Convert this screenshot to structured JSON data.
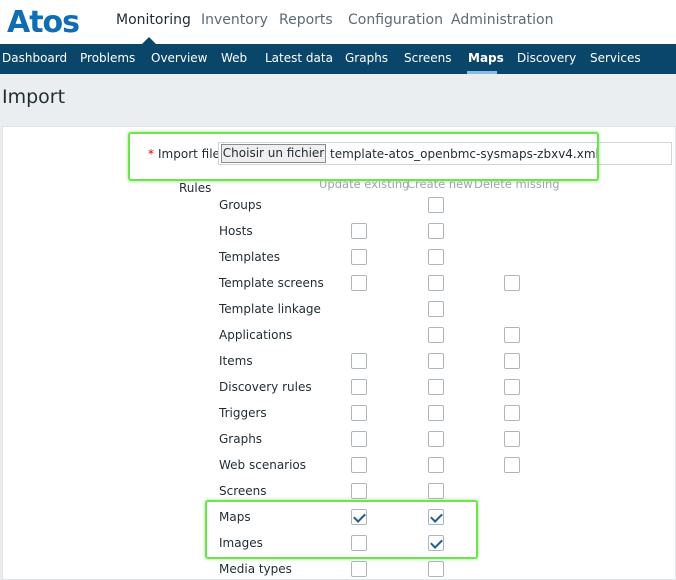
{
  "header": {
    "logo": "Atos",
    "menu": [
      {
        "label": "Monitoring",
        "active": true
      },
      {
        "label": "Inventory",
        "active": false
      },
      {
        "label": "Reports",
        "active": false
      },
      {
        "label": "Configuration",
        "active": false
      },
      {
        "label": "Administration",
        "active": false
      }
    ]
  },
  "subnav": [
    {
      "label": "Dashboard",
      "active": false
    },
    {
      "label": "Problems",
      "active": false
    },
    {
      "label": "Overview",
      "active": false
    },
    {
      "label": "Web",
      "active": false
    },
    {
      "label": "Latest data",
      "active": false
    },
    {
      "label": "Graphs",
      "active": false
    },
    {
      "label": "Screens",
      "active": false
    },
    {
      "label": "Maps",
      "active": true
    },
    {
      "label": "Discovery",
      "active": false
    },
    {
      "label": "Services",
      "active": false
    }
  ],
  "page_title": "Import",
  "import_file": {
    "required_mark": "*",
    "label": "Import file",
    "button": "Choisir un fichier",
    "filename": "template-atos_openbmc-sysmaps-zbxv4.xml"
  },
  "rules": {
    "label": "Rules",
    "columns": [
      "Update existing",
      "Create new",
      "Delete missing"
    ],
    "rows": [
      {
        "label": "Groups",
        "update": null,
        "create": false,
        "delete": null
      },
      {
        "label": "Hosts",
        "update": false,
        "create": false,
        "delete": null
      },
      {
        "label": "Templates",
        "update": false,
        "create": false,
        "delete": null
      },
      {
        "label": "Template screens",
        "update": false,
        "create": false,
        "delete": false
      },
      {
        "label": "Template linkage",
        "update": null,
        "create": false,
        "delete": null
      },
      {
        "label": "Applications",
        "update": null,
        "create": false,
        "delete": false
      },
      {
        "label": "Items",
        "update": false,
        "create": false,
        "delete": false
      },
      {
        "label": "Discovery rules",
        "update": false,
        "create": false,
        "delete": false
      },
      {
        "label": "Triggers",
        "update": false,
        "create": false,
        "delete": false
      },
      {
        "label": "Graphs",
        "update": false,
        "create": false,
        "delete": false
      },
      {
        "label": "Web scenarios",
        "update": false,
        "create": false,
        "delete": false
      },
      {
        "label": "Screens",
        "update": false,
        "create": false,
        "delete": null
      },
      {
        "label": "Maps",
        "update": true,
        "create": true,
        "delete": null
      },
      {
        "label": "Images",
        "update": false,
        "create": true,
        "delete": null
      },
      {
        "label": "Media types",
        "update": false,
        "create": false,
        "delete": null
      }
    ]
  },
  "colors": {
    "brand": "#0f6db5",
    "nav_background": "#0a466a",
    "active_underline": "#89bde5",
    "required_star": "#d40000",
    "highlight": "#6fe34f",
    "check_mark": "#1f5f8b"
  }
}
